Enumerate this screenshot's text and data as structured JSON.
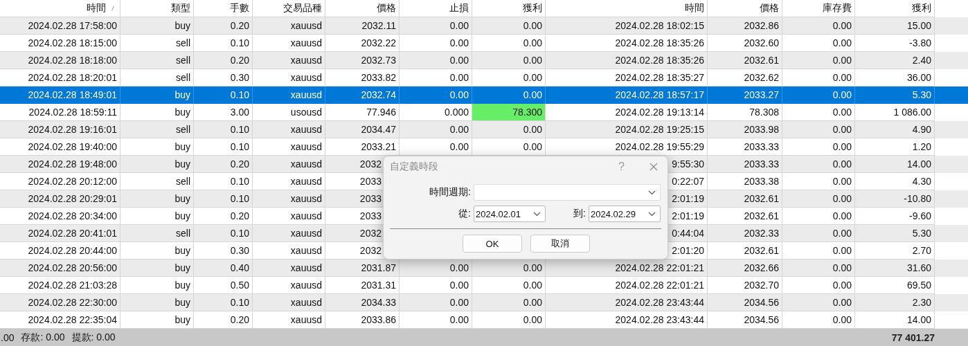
{
  "table": {
    "columns": [
      {
        "label": "時間",
        "sorted": true
      },
      {
        "label": "類型",
        "sorted": false
      },
      {
        "label": "手數",
        "sorted": false
      },
      {
        "label": "交易品種",
        "sorted": false
      },
      {
        "label": "價格",
        "sorted": false
      },
      {
        "label": "止損",
        "sorted": false
      },
      {
        "label": "獲利",
        "sorted": false
      },
      {
        "label": "時間",
        "sorted": false
      },
      {
        "label": "價格",
        "sorted": false
      },
      {
        "label": "庫存費",
        "sorted": false
      },
      {
        "label": "獲利",
        "sorted": false
      }
    ],
    "rows": [
      {
        "selected": false,
        "hit": false,
        "cells": [
          "2024.02.28 17:58:00",
          "buy",
          "0.20",
          "xauusd",
          "2032.11",
          "0.00",
          "0.00",
          "2024.02.28 18:02:15",
          "2032.86",
          "0.00",
          "15.00"
        ]
      },
      {
        "selected": false,
        "hit": false,
        "cells": [
          "2024.02.28 18:15:00",
          "sell",
          "0.10",
          "xauusd",
          "2032.22",
          "0.00",
          "0.00",
          "2024.02.28 18:35:26",
          "2032.60",
          "0.00",
          "-3.80"
        ]
      },
      {
        "selected": false,
        "hit": false,
        "cells": [
          "2024.02.28 18:18:00",
          "sell",
          "0.20",
          "xauusd",
          "2032.73",
          "0.00",
          "0.00",
          "2024.02.28 18:35:26",
          "2032.61",
          "0.00",
          "2.40"
        ]
      },
      {
        "selected": false,
        "hit": false,
        "cells": [
          "2024.02.28 18:20:01",
          "sell",
          "0.30",
          "xauusd",
          "2033.82",
          "0.00",
          "0.00",
          "2024.02.28 18:35:27",
          "2032.62",
          "0.00",
          "36.00"
        ]
      },
      {
        "selected": true,
        "hit": false,
        "cells": [
          "2024.02.28 18:49:01",
          "buy",
          "0.10",
          "xauusd",
          "2032.74",
          "0.00",
          "0.00",
          "2024.02.28 18:57:17",
          "2033.27",
          "0.00",
          "5.30"
        ]
      },
      {
        "selected": false,
        "hit": true,
        "cells": [
          "2024.02.28 18:59:11",
          "buy",
          "3.00",
          "usousd",
          "77.946",
          "0.000",
          "78.300",
          "2024.02.28 19:13:14",
          "78.308",
          "0.00",
          "1 086.00"
        ]
      },
      {
        "selected": false,
        "hit": false,
        "cells": [
          "2024.02.28 19:16:01",
          "sell",
          "0.10",
          "xauusd",
          "2034.47",
          "0.00",
          "0.00",
          "2024.02.28 19:25:15",
          "2033.98",
          "0.00",
          "4.90"
        ]
      },
      {
        "selected": false,
        "hit": false,
        "cells": [
          "2024.02.28 19:40:00",
          "buy",
          "0.10",
          "xauusd",
          "2033.21",
          "0.00",
          "0.00",
          "2024.02.28 19:55:29",
          "2033.33",
          "0.00",
          "1.20"
        ]
      },
      {
        "selected": false,
        "cells": [
          "2024.02.28 19:48:00",
          "buy",
          "0.20",
          "xauusd",
          "2032",
          null,
          null,
          "9:55:30",
          "2033.33",
          "0.00",
          "14.00"
        ]
      },
      {
        "selected": false,
        "cells": [
          "2024.02.28 20:12:00",
          "sell",
          "0.10",
          "xauusd",
          "2033",
          null,
          null,
          "0:22:07",
          "2033.38",
          "0.00",
          "4.30"
        ]
      },
      {
        "selected": false,
        "cells": [
          "2024.02.28 20:29:01",
          "buy",
          "0.10",
          "xauusd",
          "2033",
          null,
          null,
          "2:01:19",
          "2032.61",
          "0.00",
          "-10.80"
        ]
      },
      {
        "selected": false,
        "cells": [
          "2024.02.28 20:34:00",
          "buy",
          "0.20",
          "xauusd",
          "2033",
          null,
          null,
          "2:01:19",
          "2032.61",
          "0.00",
          "-9.60"
        ]
      },
      {
        "selected": false,
        "cells": [
          "2024.02.28 20:41:01",
          "sell",
          "0.10",
          "xauusd",
          "2032",
          null,
          null,
          "0:44:04",
          "2032.33",
          "0.00",
          "5.30"
        ]
      },
      {
        "selected": false,
        "cells": [
          "2024.02.28 20:44:00",
          "buy",
          "0.30",
          "xauusd",
          "2032",
          null,
          null,
          "2:01:20",
          "2032.61",
          "0.00",
          "2.70"
        ]
      },
      {
        "selected": false,
        "hit": false,
        "cells": [
          "2024.02.28 20:56:00",
          "buy",
          "0.40",
          "xauusd",
          "2031.87",
          "0.00",
          "0.00",
          "2024.02.28 22:01:21",
          "2032.66",
          "0.00",
          "31.60"
        ]
      },
      {
        "selected": false,
        "hit": false,
        "cells": [
          "2024.02.28 21:03:28",
          "buy",
          "0.50",
          "xauusd",
          "2031.31",
          "0.00",
          "0.00",
          "2024.02.28 22:01:21",
          "2032.70",
          "0.00",
          "69.50"
        ]
      },
      {
        "selected": false,
        "hit": false,
        "cells": [
          "2024.02.28 22:30:00",
          "buy",
          "0.10",
          "xauusd",
          "2034.33",
          "0.00",
          "0.00",
          "2024.02.28 23:43:44",
          "2034.56",
          "0.00",
          "2.30"
        ]
      },
      {
        "selected": false,
        "hit": false,
        "cells": [
          "2024.02.28 22:35:04",
          "buy",
          "0.20",
          "xauusd",
          "2033.86",
          "0.00",
          "0.00",
          "2024.02.28 23:43:44",
          "2034.56",
          "0.00",
          "14.00"
        ]
      }
    ]
  },
  "status_bar": {
    "items": [
      ".00",
      "存款: 0.00",
      "提款: 0.00"
    ],
    "total": "77 401.27"
  },
  "dialog": {
    "title": "自定義時段",
    "help": "?",
    "period": {
      "label": "時間週期:"
    },
    "from": {
      "label": "從:",
      "value": "2024.02.01"
    },
    "to": {
      "label": "到:",
      "value": "2024.02.29"
    },
    "buttons": [
      "OK",
      "取消"
    ]
  }
}
